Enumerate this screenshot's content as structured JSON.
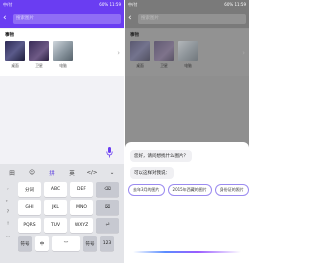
{
  "status": {
    "left": "中/付",
    "right": "60% 11:59"
  },
  "search": {
    "placeholder": "搜索图片"
  },
  "section": {
    "title": "事物"
  },
  "photos": [
    {
      "caption": "桌面"
    },
    {
      "caption": "卫星"
    },
    {
      "caption": "电脑"
    }
  ],
  "keyboard": {
    "toolbar": [
      "田",
      "☺",
      "拼",
      "英",
      "</>",
      "⌄"
    ],
    "side": [
      ",",
      "。",
      "?",
      "!",
      "..."
    ],
    "rows": [
      [
        "分词",
        "ABC",
        "DEF",
        "⌫"
      ],
      [
        "GHI",
        "JKL",
        "MNO",
        "⌧"
      ],
      [
        "PQRS",
        "TUV",
        "WXYZ",
        "⏎"
      ]
    ],
    "bottom": [
      "符号",
      "中",
      "︺",
      "符号",
      "123"
    ]
  },
  "assistant": {
    "question": "您好，请问想找什么图片？",
    "hint": "可以这样对我说：",
    "chips": [
      "去年3月的图片",
      "2015年西藏的图片",
      "身份证的照片"
    ]
  },
  "colors": {
    "brand": "#6a3df2",
    "mic": "#6a3df2"
  }
}
